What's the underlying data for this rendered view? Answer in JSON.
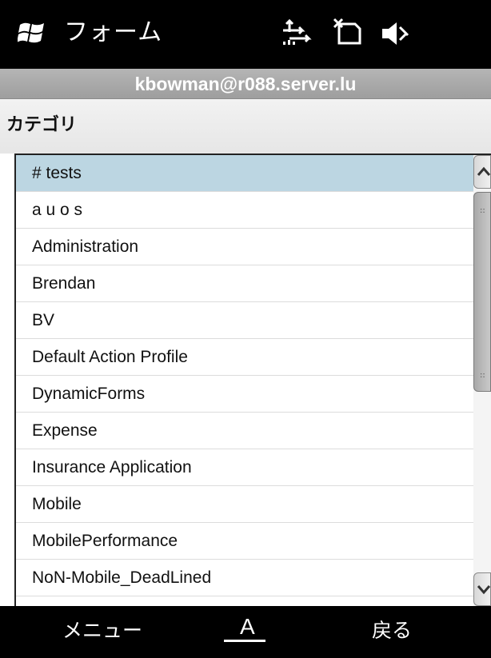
{
  "titlebar": {
    "app_title": "フォーム",
    "logo_icon": "windows-flag-icon",
    "status_icons": [
      "connectivity-arrows-icon",
      "no-sim-icon",
      "speaker-muted-icon"
    ]
  },
  "account": {
    "email": "kbowman@r088.server.lu"
  },
  "heading": {
    "title": "カテゴリ"
  },
  "list": {
    "selected_index": 0,
    "items": [
      "# tests",
      "a u o s",
      "Administration",
      "Brendan",
      "BV",
      "Default Action Profile",
      "DynamicForms",
      "Expense",
      "Insurance Application",
      "Mobile",
      "MobilePerformance",
      "NoN-Mobile_DeadLined"
    ]
  },
  "softkeys": {
    "left": "メニュー",
    "center": "A",
    "right": "戻る"
  },
  "colors": {
    "selected_row": "#bcd6e2",
    "bars": "#000000",
    "account_bar": "#a8a8a8"
  }
}
